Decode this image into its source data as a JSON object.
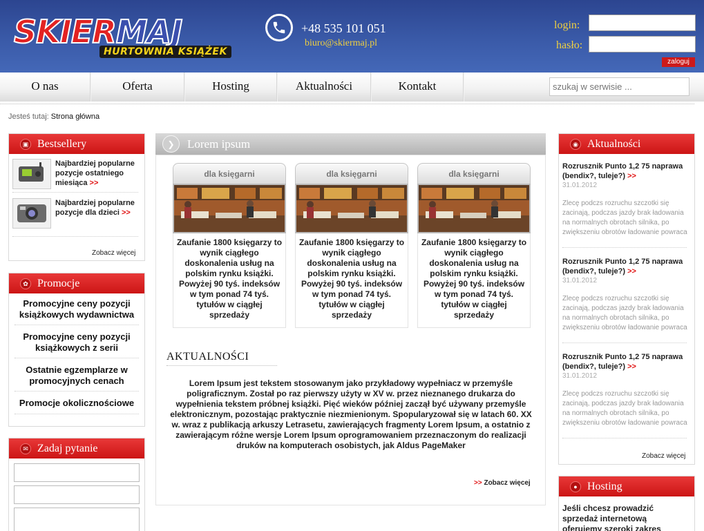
{
  "header": {
    "logo_main_1": "SKIER",
    "logo_main_2": "MAJ",
    "logo_sub": "HURTOWNIA KSIĄŻEK",
    "phone": "+48 535 101 051",
    "email": "biuro@skiermaj.pl",
    "login_label": "login:",
    "password_label": "hasło:",
    "login_button": "zaloguj"
  },
  "nav": {
    "items": [
      "O nas",
      "Oferta",
      "Hosting",
      "Aktualności",
      "Kontakt"
    ],
    "search_placeholder": "szukaj w serwisie ..."
  },
  "breadcrumb": {
    "prefix": "Jesteś tutaj:",
    "current": "Strona główna"
  },
  "bestsellery": {
    "title": "Bestsellery",
    "items": [
      {
        "text": "Najbardziej popularne pozycje ostatniego miesiąca",
        "arrow": ">>"
      },
      {
        "text": "Najbardziej popularne pozycje dla dzieci",
        "arrow": ">>"
      }
    ],
    "more": "Zobacz więcej"
  },
  "promocje": {
    "title": "Promocje",
    "items": [
      "Promocyjne ceny pozycji książkowych wydawnictwa",
      "Promocyjne ceny pozycji książkowych z serii",
      "Ostatnie egzemplarze w promocyjnych cenach",
      "Promocje okolicznościowe"
    ]
  },
  "question": {
    "title": "Zadaj pytanie"
  },
  "center": {
    "title": "Lorem ipsum",
    "cards": [
      {
        "tab": "dla księgarni",
        "text": "Zaufanie 1800 księgarzy to wynik ciągłego doskonalenia usług na polskim rynku książki. Powyżej 90 tyś. indeksów w tym ponad 74 tyś. tytułów w ciągłej sprzedaży"
      },
      {
        "tab": "dla księgarni",
        "text": "Zaufanie 1800 księgarzy to wynik ciągłego doskonalenia usług na polskim rynku książki. Powyżej 90 tyś. indeksów w tym ponad 74 tyś. tytułów w ciągłej sprzedaży"
      },
      {
        "tab": "dla księgarni",
        "text": "Zaufanie 1800 księgarzy to wynik ciągłego doskonalenia usług na polskim rynku książki. Powyżej 90 tyś. indeksów w tym ponad 74 tyś. tytułów w ciągłej sprzedaży"
      }
    ],
    "news_title": "AKTUALNOŚCI",
    "news_text": "Lorem Ipsum jest tekstem stosowanym jako przykładowy wypełniacz w przemyśle poligraficznym. Został po raz pierwszy użyty w XV w. przez nieznanego drukarza do wypełnienia tekstem próbnej książki. Pięć wieków później zaczął być używany przemyśle elektronicznym, pozostając praktycznie niezmienionym. Spopularyzował się w latach 60. XX w. wraz z publikacją arkuszy Letrasetu, zawierających fragmenty Lorem Ipsum, a ostatnio z zawierającym różne wersje Lorem Ipsum oprogramowaniem przeznaczonym do realizacji druków na komputerach osobistych, jak Aldus PageMaker",
    "more_arrow": ">>",
    "more": "Zobacz więcej"
  },
  "aktualnosci": {
    "title": "Aktualności",
    "items": [
      {
        "title": "Rozrusznik Punto 1,2 75 naprawa (bendix?, tuleje?)",
        "arrow": ">>",
        "date": "31.01.2012",
        "desc": "Zlecę podczs rozruchu szczotki się zacinają, podczas jazdy brak ładowania na normalnych obrotach silnika, po zwiększeniu obrotów ładowanie powraca"
      },
      {
        "title": "Rozrusznik Punto 1,2 75 naprawa (bendix?, tuleje?)",
        "arrow": ">>",
        "date": "31.01.2012",
        "desc": "Zlecę podczs rozruchu szczotki się zacinają, podczas jazdy brak ładowania na normalnych obrotach silnika, po zwiększeniu obrotów ładowanie powraca"
      },
      {
        "title": "Rozrusznik Punto 1,2 75 naprawa (bendix?, tuleje?)",
        "arrow": ">>",
        "date": "31.01.2012",
        "desc": "Zlecę podczs rozruchu szczotki się zacinają, podczas jazdy brak ładowania na normalnych obrotach silnika, po zwiększeniu obrotów ładowanie powraca"
      }
    ],
    "more": "Zobacz więcej"
  },
  "hosting": {
    "title": "Hosting",
    "text": "Jeśli chcesz prowadzić sprzedaż internetową oferujemy szeroki zakres usług:"
  },
  "colors": {
    "header_blue": "#3a5aa8",
    "accent_red": "#cc1515",
    "label_yellow": "#f0d040"
  }
}
